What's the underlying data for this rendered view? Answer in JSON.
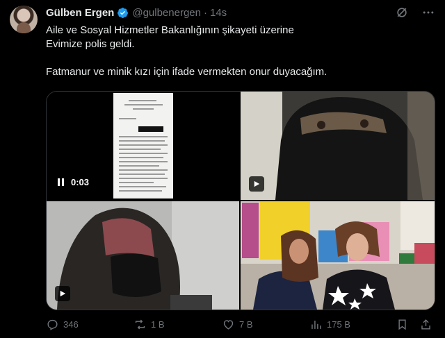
{
  "post": {
    "author_name": "Gülben Ergen",
    "handle": "@gulbenergen",
    "separator": "·",
    "time": "14s",
    "text_line1": "Aile ve Sosyal Hizmetler Bakanlığının şikayeti üzerine",
    "text_line2": "Evimize polis geldi.",
    "text_line3": "Fatmanur ve minik kızı için ifade vermekten onur duyacağım."
  },
  "media": {
    "video1_time": "0:03"
  },
  "actions": {
    "replies": "346",
    "reposts": "1 B",
    "likes": "7 B",
    "views": "175 B"
  },
  "colors": {
    "background": "#000000",
    "text": "#e7e9ea",
    "muted": "#71767b",
    "verified": "#1d9bf0"
  }
}
